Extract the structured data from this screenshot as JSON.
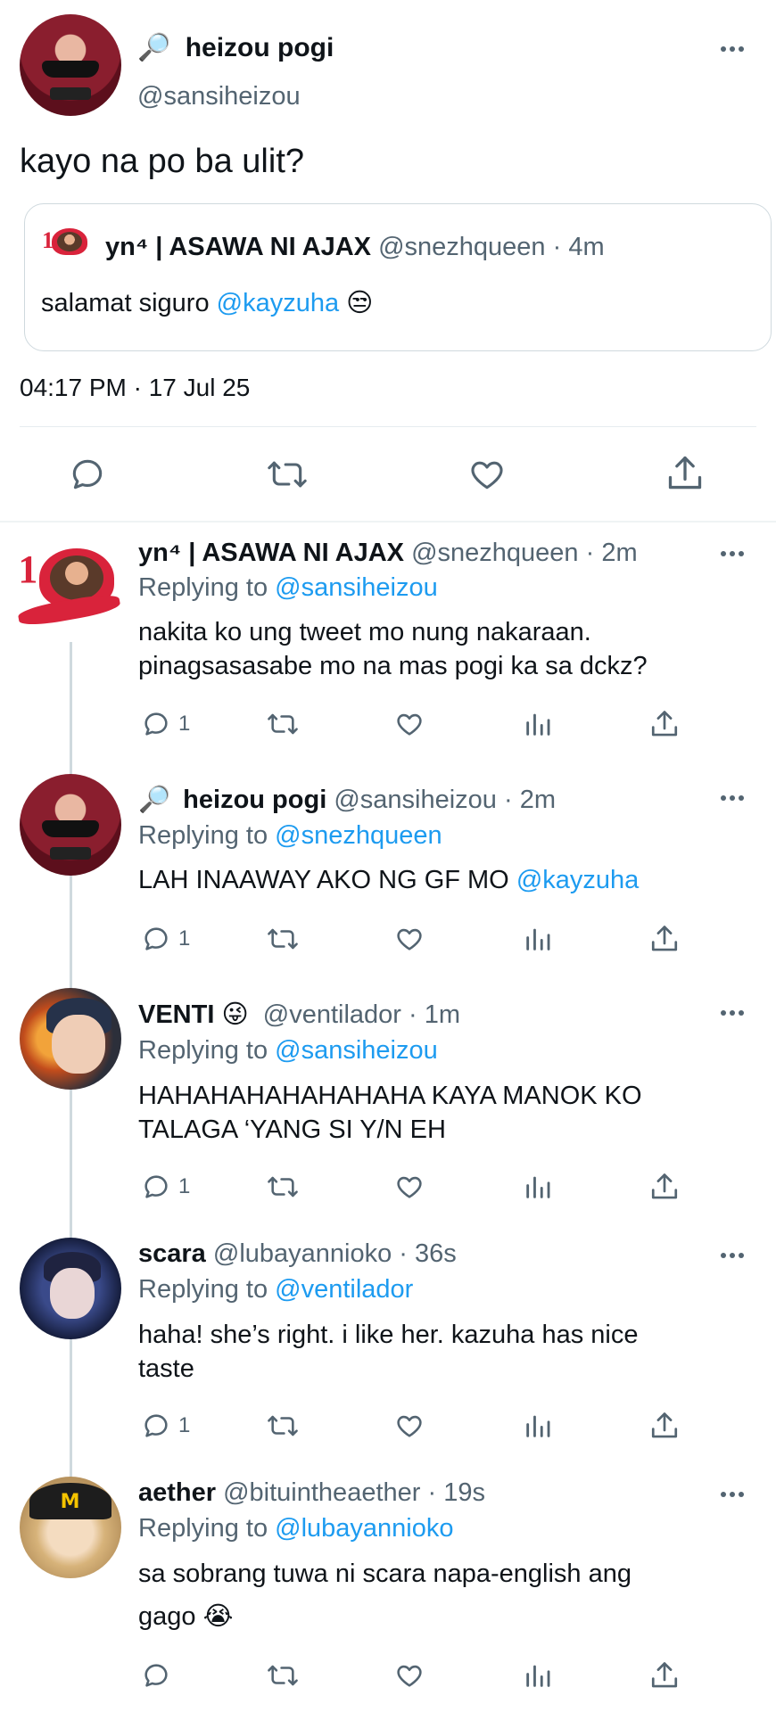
{
  "main": {
    "name": "heizou pogi",
    "name_icon": "🔎",
    "handle": "@sansiheizou",
    "text": "kayo na po ba ulit?",
    "quote": {
      "name": "yn⁴ | ASAWA NI AJAX",
      "handle": "@snezhqueen",
      "time": "· 4m",
      "text_prefix": "salamat siguro ",
      "mention": "@kayzuha",
      "emoji": "😒"
    },
    "timestamp": "04:17 PM · 17 Jul 25"
  },
  "replies": [
    {
      "name": "yn⁴ | ASAWA NI AJAX",
      "handle": "@snezhqueen · 2m",
      "replying_to_label": "Replying to",
      "replying_to": "@sansiheizou",
      "lines": [
        "nakita ko ung tweet mo nung nakaraan.",
        "pinagsasasabe mo na mas pogi ka sa dckz?"
      ],
      "reply_count": "1"
    },
    {
      "name_icon": "🔎",
      "name": "heizou pogi",
      "handle": "@sansiheizou · 2m",
      "replying_to_label": "Replying to",
      "replying_to": "@snezhqueen",
      "text_prefix": "LAH INAAWAY AKO NG GF MO ",
      "mention": "@kayzuha",
      "reply_count": "1"
    },
    {
      "name": "VENTI",
      "name_emoji": "😜",
      "handle": "@ventilador · 1m",
      "replying_to_label": "Replying to",
      "replying_to": "@sansiheizou",
      "lines": [
        "HAHAHAHAHAHAHAHA KAYA MANOK KO",
        "TALAGA ‘YANG SI Y/N EH"
      ],
      "reply_count": "1"
    },
    {
      "name": "scara",
      "handle": "@lubayannioko · 36s",
      "replying_to_label": "Replying to",
      "replying_to": "@ventilador",
      "lines": [
        "haha! she’s right. i like her. kazuha has nice",
        "taste"
      ],
      "reply_count": "1"
    },
    {
      "name": "aether",
      "handle": "@bituintheaether · 19s",
      "replying_to_label": "Replying to",
      "replying_to": "@lubayannioko",
      "lines": [
        "sa sobrang tuwa ni scara napa-english ang"
      ],
      "line2": "gago",
      "line2_emoji": "😭",
      "reply_count": ""
    }
  ]
}
